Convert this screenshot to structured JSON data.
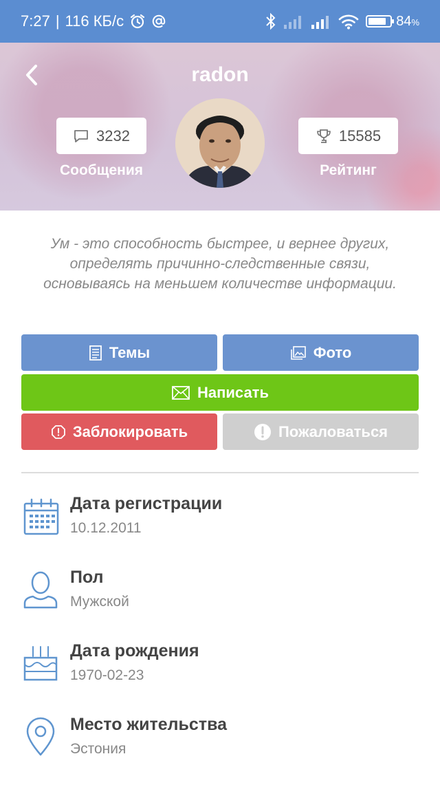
{
  "status_bar": {
    "time": "7:27",
    "separator": "|",
    "speed": "116 КБ/с",
    "battery_percent": "84",
    "battery_unit": "%",
    "battery_level": 0.84
  },
  "header": {
    "title": "radon",
    "messages_count": "3232",
    "messages_label": "Сообщения",
    "rating_count": "15585",
    "rating_label": "Рейтинг"
  },
  "quote": "Ум - это способность быстрее, и вернее других, определять причинно-следственные связи,  основываясь на меньшем количестве информации.",
  "buttons": {
    "topics": "Темы",
    "photo": "Фото",
    "write": "Написать",
    "block": "Заблокировать",
    "report": "Пожаловаться"
  },
  "info": [
    {
      "title": "Дата регистрации",
      "value": "10.12.2011",
      "icon": "calendar-icon"
    },
    {
      "title": "Пол",
      "value": "Мужской",
      "icon": "person-icon"
    },
    {
      "title": "Дата рождения",
      "value": "1970-02-23",
      "icon": "cake-icon"
    },
    {
      "title": "Место жительства",
      "value": "Эстония",
      "icon": "location-pin-icon"
    }
  ],
  "colors": {
    "status_bar": "#5b8dd1",
    "blue_button": "#6b93cf",
    "green_button": "#6ec617",
    "red_button": "#e05a5e",
    "gray_button": "#cfcfcf",
    "icon_blue": "#5f95cf"
  }
}
